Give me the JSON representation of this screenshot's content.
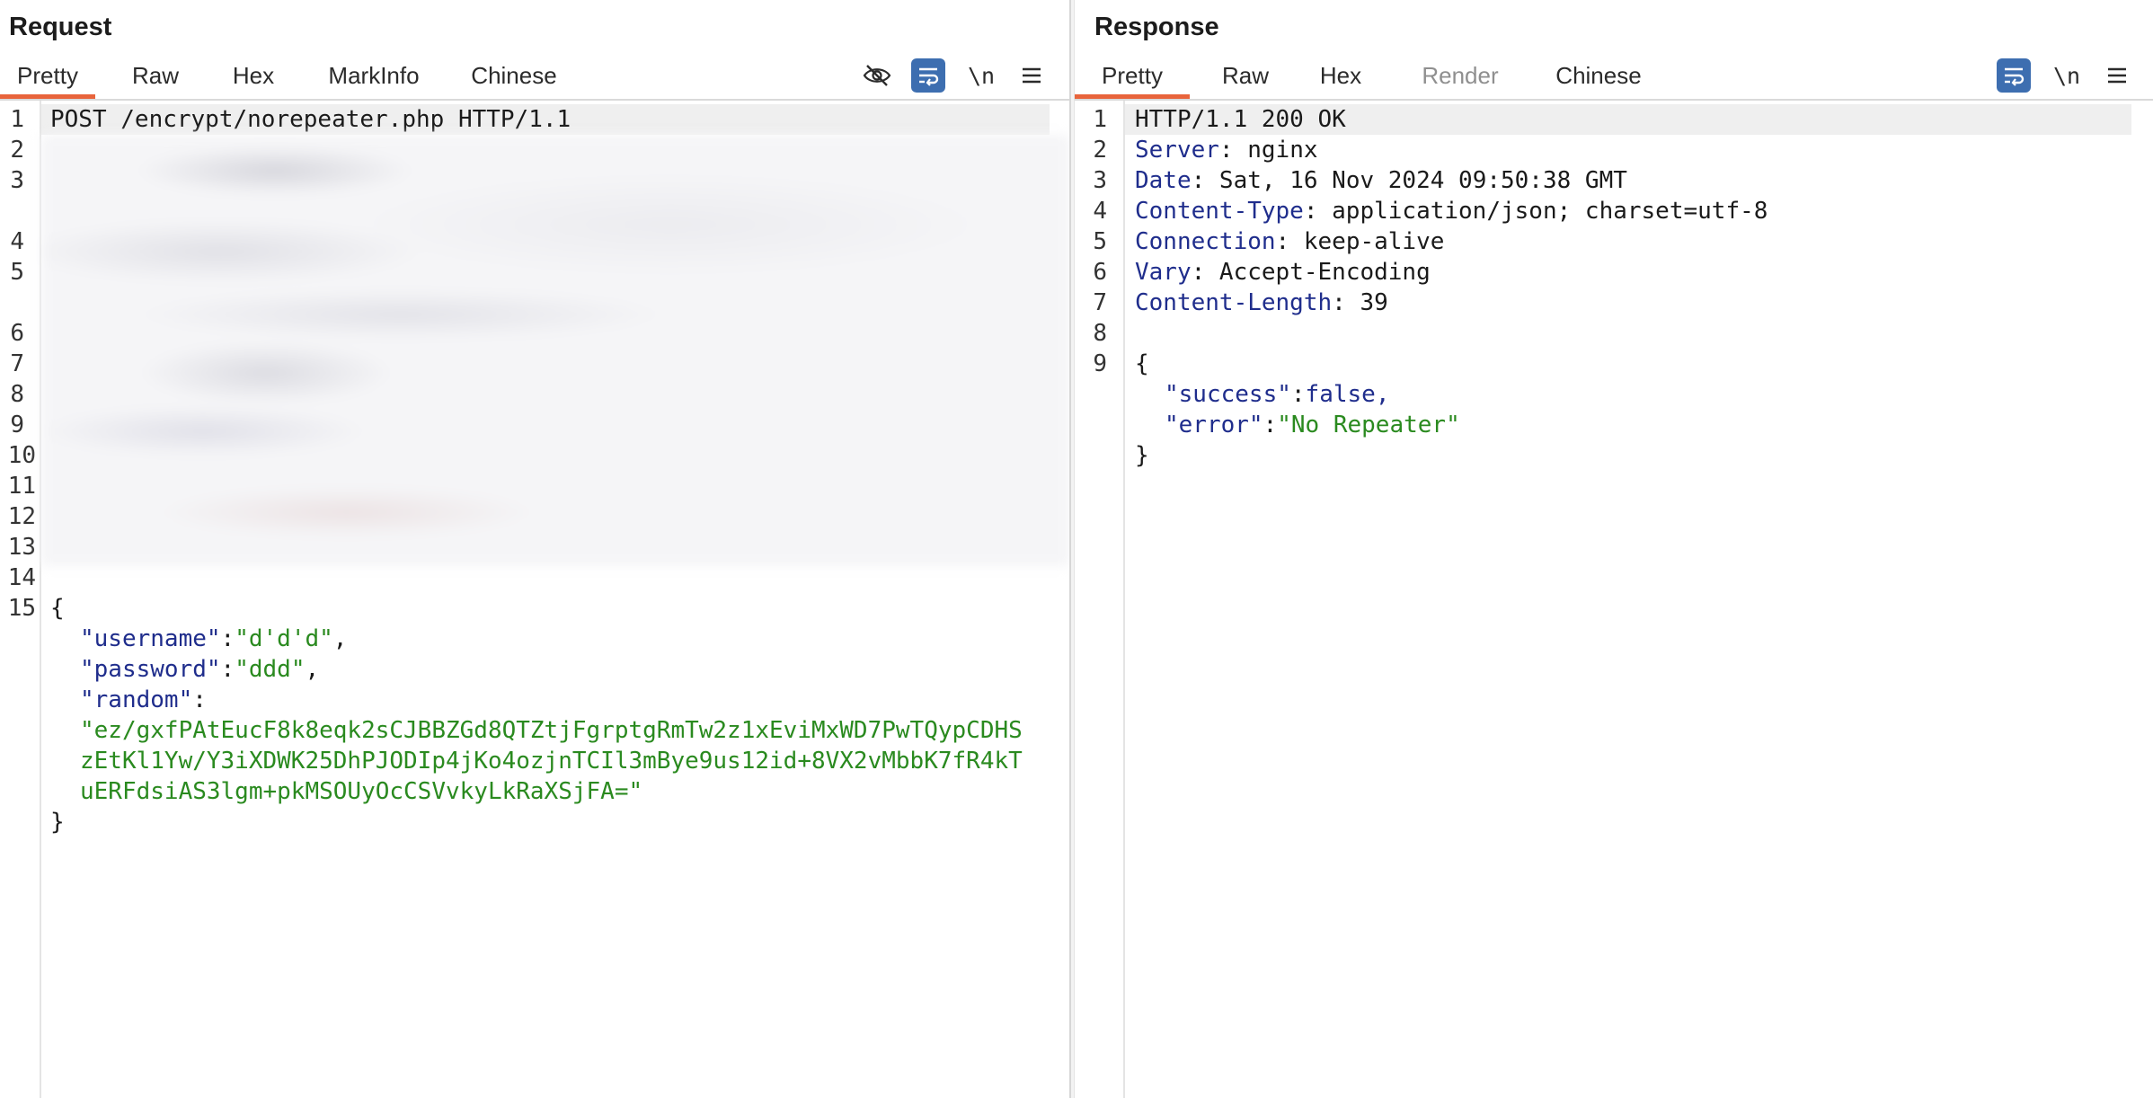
{
  "request": {
    "title": "Request",
    "tabs": [
      "Pretty",
      "Raw",
      "Hex",
      "MarkInfo",
      "Chinese"
    ],
    "active_tab": "Pretty",
    "toolbar": {
      "newline_label": "\\n"
    },
    "line_numbers": [
      "1",
      "2",
      "3",
      "4",
      "5",
      "6",
      "7",
      "8",
      "9",
      "10",
      "11",
      "12",
      "13",
      "14",
      "15"
    ],
    "request_line": "POST /encrypt/norepeater.php HTTP/1.1",
    "body": {
      "open_brace": "{",
      "username_key": "\"username\"",
      "username_value": "\"d'd'd\"",
      "password_key": "\"password\"",
      "password_value": "\"ddd\"",
      "random_key": "\"random\"",
      "random_value_line1": "\"ez/gxfPAtEucF8k8eqk2sCJBBZGd8QTZtjFgrptgRmTw2z1xEviMxWD7PwTQypCDHS",
      "random_value_line2": "zEtKl1Yw/Y3iXDWK25DhPJODIp4jKo4ozjnTCIl3mBye9us12id+8VX2vMbbK7fR4kT",
      "random_value_line3": "uERFdsiAS3lgm+pkMSOUyOcCSVvkyLkRaXSjFA=\"",
      "close_brace": "}"
    }
  },
  "response": {
    "title": "Response",
    "tabs": [
      "Pretty",
      "Raw",
      "Hex",
      "Render",
      "Chinese"
    ],
    "active_tab": "Pretty",
    "toolbar": {
      "newline_label": "\\n"
    },
    "line_numbers": [
      "1",
      "2",
      "3",
      "4",
      "5",
      "6",
      "7",
      "8",
      "9"
    ],
    "status_line": "HTTP/1.1 200 OK",
    "headers": [
      {
        "name": "Server",
        "value": " nginx"
      },
      {
        "name": "Date",
        "value": " Sat, 16 Nov 2024 09:50:38 GMT"
      },
      {
        "name": "Content-Type",
        "value": " application/json; charset=utf-8"
      },
      {
        "name": "Connection",
        "value": " keep-alive"
      },
      {
        "name": "Vary",
        "value": " Accept-Encoding"
      },
      {
        "name": "Content-Length",
        "value": " 39"
      }
    ],
    "body": {
      "open_brace": "{",
      "success_key": "\"success\"",
      "success_value": "false,",
      "error_key": "\"error\"",
      "error_value": "\"No Repeater\"",
      "close_brace": "}"
    }
  },
  "colors": {
    "accent_tab": "#e8643c",
    "header_key": "#1f2d8c",
    "json_string": "#2a8a1f",
    "toggle_blue": "#3d6eb0"
  }
}
